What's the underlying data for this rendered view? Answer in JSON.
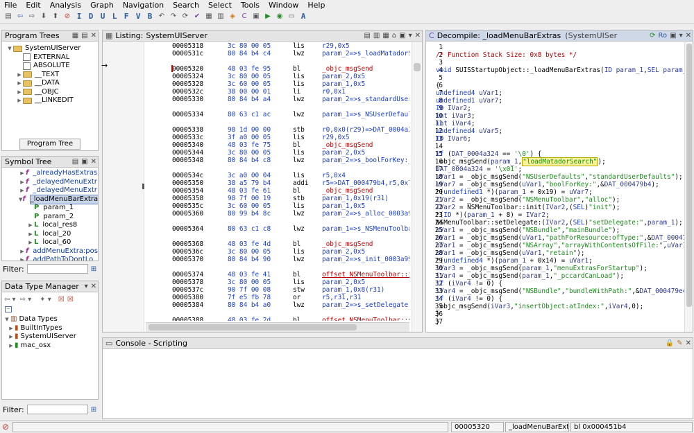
{
  "menu": [
    "File",
    "Edit",
    "Analysis",
    "Graph",
    "Navigation",
    "Search",
    "Select",
    "Tools",
    "Window",
    "Help"
  ],
  "program_trees": {
    "title": "Program Trees",
    "root": "SystemUIServer",
    "children": [
      "EXTERNAL",
      "ABSOLUTE",
      "__TEXT",
      "__DATA",
      "__OBJC",
      "__LINKEDIT"
    ],
    "tab_label": "Program Tree"
  },
  "symbol_tree": {
    "title": "Symbol Tree",
    "items": [
      {
        "label": "_alreadyHasExtras"
      },
      {
        "label": "_delayedMenuExtr"
      },
      {
        "label": "_delayedMenuExtr"
      },
      {
        "label": "_loadMenuBarExtra"
      }
    ],
    "children": [
      "param_1",
      "param_2",
      "local_res8",
      "local_20",
      "local_60"
    ],
    "after": [
      "addMenuExtra:pos",
      "addPathToDontLo"
    ],
    "filter_label": "Filter:"
  },
  "data_type_manager": {
    "title": "Data Type Manager",
    "root": "Data Types",
    "children": [
      "BuiltInTypes",
      "SystemUIServer",
      "mac_osx"
    ],
    "filter_label": "Filter:"
  },
  "listing": {
    "title": "Listing:",
    "program": "SystemUIServer",
    "rows": [
      {
        "addr": "00005318",
        "bytes": "3c 80 00 05",
        "mn": "lis",
        "op": "r29,0x5",
        "kind": "blue"
      },
      {
        "addr": "0000531c",
        "bytes": "80 84 b4 c4",
        "mn": "lwz",
        "op": "param_2=>s_loadMatadorSearch_0003",
        "kind": "blue"
      },
      {
        "addr": "",
        "bytes": "",
        "mn": "",
        "op": "",
        "kind": "blank"
      },
      {
        "addr": "00005320",
        "bytes": "48 03 fe 95",
        "mn": "bl",
        "op": "_objc_msgSend",
        "kind": "red"
      },
      {
        "addr": "00005324",
        "bytes": "3c 80 00 05",
        "mn": "lis",
        "op": "param_2,0x5",
        "kind": "blue"
      },
      {
        "addr": "00005328",
        "bytes": "3c 60 00 05",
        "mn": "lis",
        "op": "param_1,0x5",
        "kind": "blue"
      },
      {
        "addr": "0000532c",
        "bytes": "38 00 00 01",
        "mn": "li",
        "op": "r0,0x1",
        "kind": "blue"
      },
      {
        "addr": "00005330",
        "bytes": "80 84 b4 a4",
        "mn": "lwz",
        "op": "param_2=>s_standardUserDefaults_0",
        "kind": "blue"
      },
      {
        "addr": "",
        "bytes": "",
        "mn": "",
        "op": "",
        "kind": "blank"
      },
      {
        "addr": "00005334",
        "bytes": "80 63 c1 ac",
        "mn": "lwz",
        "op": "param_1=>s_NSUserDefaults_0003b2d",
        "kind": "blue"
      },
      {
        "addr": "",
        "bytes": "",
        "mn": "",
        "op": "",
        "kind": "blank"
      },
      {
        "addr": "00005338",
        "bytes": "98 1d 00 00",
        "mn": "stb",
        "op": "r0,0x0(r29)=>DAT_0004a324",
        "kind": "blue"
      },
      {
        "addr": "0000533c",
        "bytes": "3f a0 00 05",
        "mn": "lis",
        "op": "r29,0x5",
        "kind": "blue"
      },
      {
        "addr": "00005340",
        "bytes": "48 03 fe 75",
        "mn": "bl",
        "op": "_objc_msgSend",
        "kind": "red"
      },
      {
        "addr": "00005344",
        "bytes": "3c 80 00 05",
        "mn": "lis",
        "op": "param_2,0x5",
        "kind": "blue"
      },
      {
        "addr": "00005348",
        "bytes": "80 84 b4 c8",
        "mn": "lwz",
        "op": "param_2=>s_boolForKey:_0003b838,~",
        "kind": "blue"
      },
      {
        "addr": "",
        "bytes": "",
        "mn": "",
        "op": "",
        "kind": "blank"
      },
      {
        "addr": "0000534c",
        "bytes": "3c a0 00 04",
        "mn": "lis",
        "op": "r5,0x4",
        "kind": "blue"
      },
      {
        "addr": "00005350",
        "bytes": "38 a5 79 b4",
        "mn": "addi",
        "op": "r5=>DAT_000479b4,r5,0x79b4",
        "kind": "blue"
      },
      {
        "addr": "00005354",
        "bytes": "48 03 fe 61",
        "mn": "bl",
        "op": "_objc_msgSend",
        "kind": "red"
      },
      {
        "addr": "00005358",
        "bytes": "98 7f 00 19",
        "mn": "stb",
        "op": "param_1,0x19(r31)",
        "kind": "blue"
      },
      {
        "addr": "0000535c",
        "bytes": "3c 60 00 05",
        "mn": "lis",
        "op": "param_1,0x5",
        "kind": "blue"
      },
      {
        "addr": "00005360",
        "bytes": "80 99 b4 8c",
        "mn": "lwz",
        "op": "param_2=>s_alloc_0003a988,~0x4b74",
        "kind": "blue"
      },
      {
        "addr": "",
        "bytes": "",
        "mn": "",
        "op": "",
        "kind": "blank"
      },
      {
        "addr": "00005364",
        "bytes": "80 63 c1 c8",
        "mn": "lwz",
        "op": "param_1=>s_NSMenuToolbar_0003b34c",
        "kind": "blue"
      },
      {
        "addr": "",
        "bytes": "",
        "mn": "",
        "op": "",
        "kind": "blank"
      },
      {
        "addr": "00005368",
        "bytes": "48 03 fe 4d",
        "mn": "bl",
        "op": "_objc_msgSend",
        "kind": "red"
      },
      {
        "addr": "0000536c",
        "bytes": "3c 80 00 05",
        "mn": "lis",
        "op": "param_2,0x5",
        "kind": "blue"
      },
      {
        "addr": "00005370",
        "bytes": "80 84 b4 90",
        "mn": "lwz",
        "op": "param_2=>s_init_0003a990,~0x4b70(",
        "kind": "blue"
      },
      {
        "addr": "",
        "bytes": "",
        "mn": "",
        "op": "",
        "kind": "blank"
      },
      {
        "addr": "00005374",
        "bytes": "48 03 fe 41",
        "mn": "bl",
        "op": "offset NSMenuToolbar::init",
        "kind": "fn"
      },
      {
        "addr": "00005378",
        "bytes": "3c 80 00 05",
        "mn": "lis",
        "op": "param_2,0x5",
        "kind": "blue"
      },
      {
        "addr": "0000537c",
        "bytes": "90 7f 00 08",
        "mn": "stw",
        "op": "param_1,0x8(r31)",
        "kind": "blue"
      },
      {
        "addr": "00005380",
        "bytes": "7f e5 fb 78",
        "mn": "or",
        "op": "r5,r31,r31",
        "kind": "blue"
      },
      {
        "addr": "00005384",
        "bytes": "80 84 b4 a0",
        "mn": "lwz",
        "op": "param_2=>s_setDelegate:_0003b7ac,",
        "kind": "blue"
      },
      {
        "addr": "",
        "bytes": "",
        "mn": "",
        "op": "",
        "kind": "blank"
      },
      {
        "addr": "00005388",
        "bytes": "48 03 fe 2d",
        "mn": "bl",
        "op": "offset NSMenuToolbar::setDelegate",
        "kind": "fn"
      },
      {
        "addr": "0000538c",
        "bytes": "3c 80 00 05",
        "mn": "lis",
        "op": "param_2,0x5",
        "kind": "blue"
      }
    ]
  },
  "decompile": {
    "title": "Decompile: _loadMenuBarExtras",
    "program": "(SystemUISer",
    "lines": [
      "1",
      "2",
      "3",
      "4",
      "5",
      "6",
      "7",
      "8",
      "9",
      "10",
      "11",
      "12",
      "13",
      "14",
      "15",
      "16",
      "17",
      "18",
      "19",
      "20",
      "21",
      "22",
      "23",
      "24",
      "25",
      "26",
      "27",
      "28",
      "29",
      "30",
      "31",
      "32",
      "33",
      "34",
      "35",
      "36",
      "37"
    ],
    "code": [
      "",
      "/* Function Stack Size: 0x8 bytes */",
      "",
      "void SUISStartupObject::_loadMenuBarExtras(ID param_1,SEL param_2)",
      "",
      "{",
      "  undefined4 uVar1;",
      "  undefined1 uVar7;",
      "  ID IVar2;",
      "  int iVar3;",
      "  int iVar4;",
      "  undefined4 uVar5;",
      "  ID IVar6;",
      "",
      "  if (DAT_0004a324 == '\\0') {",
      "    _objc_msgSend(param_1,\"loadMatadorSearch\");",
      "    DAT_0004a324 = '\\x01';",
      "    uVar1 = _objc_msgSend(\"NSUserDefaults\",\"standardUserDefaults\");",
      "    uVar7 = _objc_msgSend(uVar1,\"boolForKey:\",&DAT_000479b4);",
      "    *(undefined1 *)(param_1 + 0x19) = uVar7;",
      "    IVar2 = _objc_msgSend(\"NSMenuToolbar\",\"alloc\");",
      "    IVar2 = NSMenuToolbar::init(IVar2,(SEL)\"init\");",
      "    *(ID *)(param_1 + 8) = IVar2;",
      "    NSMenuToolbar::setDelegate:(IVar2,(SEL)\"setDelegate:\",param_1);",
      "    uVar1 = _objc_msgSend(\"NSBundle\",\"mainBundle\");",
      "    uVar1 = _objc_msgSend(uVar1,\"pathForResource:ofType:\",&DAT_000479c4,&D",
      "    uVar1 = _objc_msgSend(\"NSArray\",\"arrayWithContentsOfFile:\",uVar1);",
      "    uVar1 = _objc_msgSend(uVar1,\"retain\");",
      "    *(undefined4 *)(param_1 + 0x14) = uVar1;",
      "    iVar3 = _objc_msgSend(param_1,\"menuExtrasForStartup\");",
      "    iVar4 = _objc_msgSend(param_1,\"_pccardCanLoad\");",
      "    if (iVar4 != 0) {",
      "      iVar4 = _objc_msgSend(\"NSBundle\",\"bundleWithPath:\",&DAT_000479e4);",
      "      if (iVar4 != 0) {",
      "        _objc_msgSend(iVar3,\"insertObject:atIndex:\",iVar4,0);",
      "      }",
      "    }"
    ]
  },
  "console": {
    "title": "Console - Scripting"
  },
  "status": {
    "address": "00005320",
    "function": "_loadMenuBarExtr...",
    "instruction": "bl 0x000451b4"
  },
  "colors": {
    "keyword": "#1a3cc8",
    "string": "#1a8a1a",
    "comment": "#b00000",
    "highlight": "#f7f497"
  }
}
